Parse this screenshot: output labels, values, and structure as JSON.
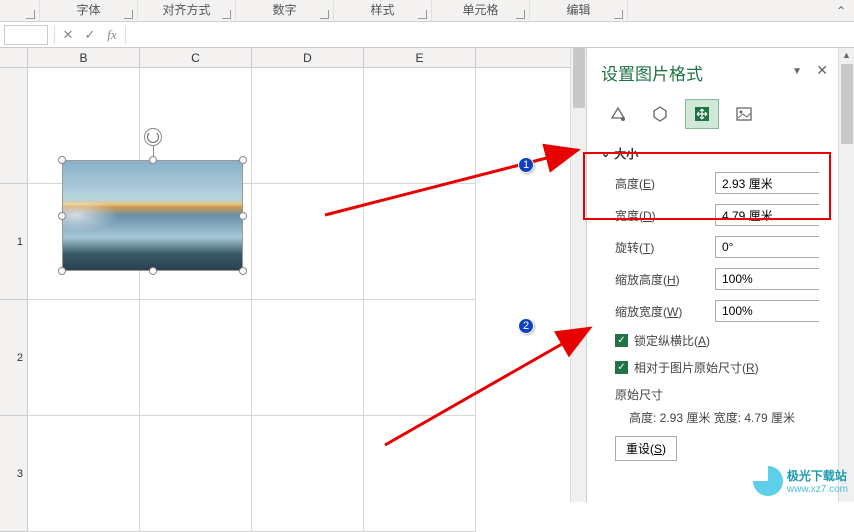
{
  "ribbon": {
    "groups": [
      "",
      "字体",
      "对齐方式",
      "数字",
      "样式",
      "单元格",
      "编辑"
    ]
  },
  "formula_bar": {
    "cancel": "✕",
    "confirm": "✓",
    "fx": "fx"
  },
  "columns": [
    "B",
    "C",
    "D",
    "E"
  ],
  "rows": [
    "1",
    "2",
    "3"
  ],
  "panel": {
    "title": "设置图片格式",
    "section_size": "大小",
    "height_label": "高度(",
    "height_u": "E",
    "height_label2": ")",
    "height_value": "2.93 厘米",
    "width_label": "宽度(",
    "width_u": "D",
    "width_label2": ")",
    "width_value": "4.79 厘米",
    "rotate_label": "旋转(",
    "rotate_u": "T",
    "rotate_label2": ")",
    "rotate_value": "0°",
    "scale_h_label": "缩放高度(",
    "scale_h_u": "H",
    "scale_h_label2": ")",
    "scale_h_value": "100%",
    "scale_w_label": "缩放宽度(",
    "scale_w_u": "W",
    "scale_w_label2": ")",
    "scale_w_value": "100%",
    "lock_aspect": "锁定纵横比(",
    "lock_aspect_u": "A",
    "lock_aspect2": ")",
    "relative_orig": "相对于图片原始尺寸(",
    "relative_orig_u": "R",
    "relative_orig2": ")",
    "original_size": "原始尺寸",
    "original_text": "高度:   2.93 厘米    宽度:   4.79 厘米",
    "reset": "重设(",
    "reset_u": "S",
    "reset2": ")"
  },
  "markers": {
    "m1": "1",
    "m2": "2"
  },
  "watermark": {
    "name": "极光下载站",
    "url": "www.xz7.com"
  }
}
